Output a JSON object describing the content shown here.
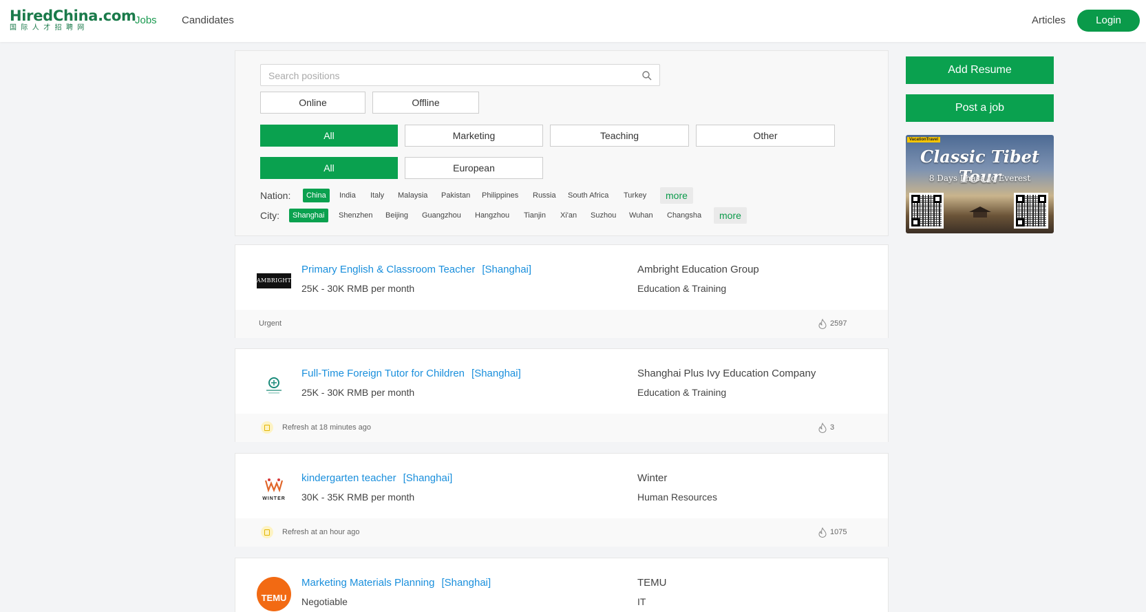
{
  "header": {
    "logo_main": "HiredChina.com",
    "logo_sub": "国际人才招聘网",
    "nav": {
      "jobs": "Jobs",
      "candidates": "Candidates",
      "articles": "Articles"
    },
    "login": "Login"
  },
  "filters": {
    "search_placeholder": "Search positions",
    "mode": [
      "Online",
      "Offline"
    ],
    "category": [
      "All",
      "Marketing",
      "Teaching",
      "Other"
    ],
    "region": [
      "All",
      "European"
    ],
    "nation_label": "Nation:",
    "nations": [
      "China",
      "India",
      "Italy",
      "Malaysia",
      "Pakistan",
      "Philippines",
      "Russia",
      "South Africa",
      "Turkey"
    ],
    "city_label": "City:",
    "cities": [
      "Shanghai",
      "Shenzhen",
      "Beijing",
      "Guangzhou",
      "Hangzhou",
      "Tianjin",
      "Xi'an",
      "Suzhou",
      "Wuhan",
      "Changsha"
    ],
    "more": "more"
  },
  "sidebar": {
    "add_resume": "Add Resume",
    "post_job": "Post a job",
    "ad": {
      "badge": "VacationTravel",
      "title": "Classic Tibet Tour",
      "subtitle": "8 Days Lhasa to Everest"
    }
  },
  "jobs": [
    {
      "logo": "AMBRIGHT",
      "title": "Primary English & Classroom Teacher",
      "city": "[Shanghai]",
      "salary": "25K - 30K RMB per month",
      "company": "Ambright Education Group",
      "industry": "Education & Training",
      "footer": "Urgent",
      "views": "2597"
    },
    {
      "logo": "",
      "title": "Full-Time Foreign Tutor for Children",
      "city": "[Shanghai]",
      "salary": "25K - 30K RMB per month",
      "company": "Shanghai Plus Ivy Education Company",
      "industry": "Education & Training",
      "footer": "Refresh at 18 minutes ago",
      "views": "3"
    },
    {
      "logo": "WINTER",
      "title": "kindergarten teacher",
      "city": "[Shanghai]",
      "salary": "30K - 35K RMB per month",
      "company": "Winter",
      "industry": "Human Resources",
      "footer": "Refresh at an hour ago",
      "views": "1075"
    },
    {
      "logo": "TEMU",
      "title": "Marketing Materials Planning",
      "city": "[Shanghai]",
      "salary": "Negotiable",
      "company": "TEMU",
      "industry": "IT",
      "footer": "",
      "views": ""
    }
  ],
  "colors": {
    "brand": "#0aa14f",
    "link": "#1a8fdc",
    "logo": "#1a7a4a"
  }
}
